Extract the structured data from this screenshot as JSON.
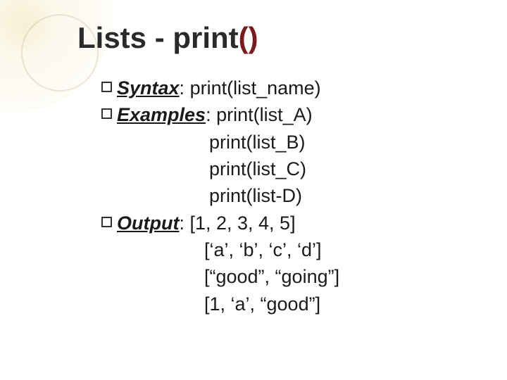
{
  "title": {
    "main": "Lists - print",
    "paren": "()"
  },
  "syntax": {
    "label": "Syntax",
    "sep": ": ",
    "value": "print(list_name)"
  },
  "examples": {
    "label": "Examples",
    "sep": ": ",
    "lines": [
      "print(list_A)",
      "print(list_B)",
      "print(list_C)",
      "print(list-D)"
    ]
  },
  "output": {
    "label": "Output",
    "sep": ": ",
    "lines": [
      "[1, 2, 3, 4, 5]",
      "[‘a’, ‘b’, ‘c’, ‘d’]",
      "[“good”, “going”]",
      "[1, ‘a’, “good”]"
    ]
  }
}
